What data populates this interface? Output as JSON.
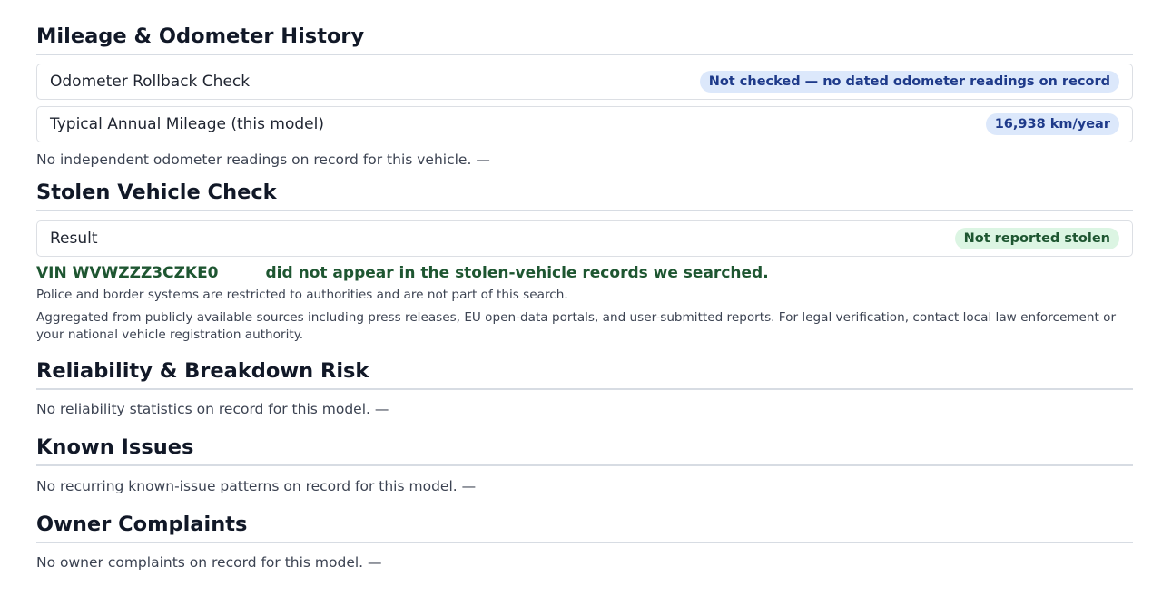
{
  "mileage": {
    "title": "Mileage & Odometer History",
    "rows": [
      {
        "label": "Odometer Rollback Check",
        "badge": "Not checked — no dated odometer readings on record"
      },
      {
        "label": "Typical Annual Mileage (this model)",
        "badge": "16,938 km/year"
      }
    ],
    "note": "No independent odometer readings on record for this vehicle. —"
  },
  "stolen": {
    "title": "Stolen Vehicle Check",
    "result_label": "Result",
    "result_badge": "Not reported stolen",
    "vin_prefix": "VIN WVWZZZ3CZKE0",
    "vin_message": "did not appear in the stolen-vehicle records we searched.",
    "restriction_note": "Police and border systems are restricted to authorities and are not part of this search.",
    "source_note": "Aggregated from publicly available sources including press releases, EU open-data portals, and user-submitted reports. For legal verification, contact local law enforcement or your national vehicle registration authority."
  },
  "reliability": {
    "title": "Reliability & Breakdown Risk",
    "note": "No reliability statistics on record for this model. —"
  },
  "known_issues": {
    "title": "Known Issues",
    "note": "No recurring known-issue patterns on record for this model. —"
  },
  "complaints": {
    "title": "Owner Complaints",
    "note": "No owner complaints on record for this model. —"
  },
  "colors": {
    "badge_blue_bg": "#dce8fb",
    "badge_blue_text": "#1e3a8a",
    "badge_green_bg": "#dcf5e3",
    "success_text": "#1e5631"
  }
}
